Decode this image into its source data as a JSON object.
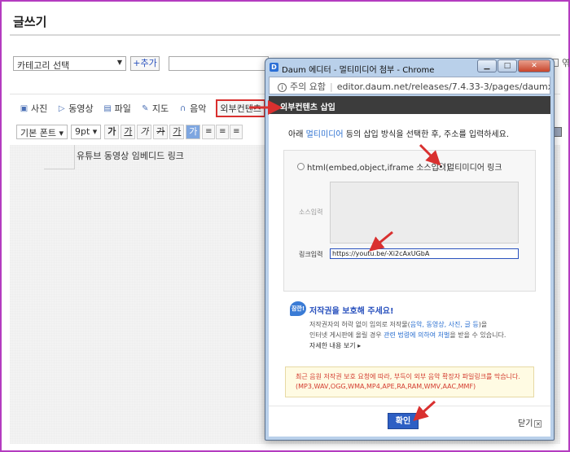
{
  "page": {
    "title": "글쓰기",
    "category_placeholder": "카테고리 선택",
    "add_label": "+추가",
    "right_label": "엮"
  },
  "toolbar": {
    "photo": "사진",
    "video": "동영상",
    "file": "파일",
    "map": "지도",
    "music": "음악",
    "external": "외부컨텐츠",
    "font": "기본 폰트",
    "size": "9pt",
    "fmt_bold": "가",
    "fmt_underline": "가",
    "fmt_italic": "가",
    "fmt_strike": "가",
    "fmt_color": "가",
    "fmt_bg": "가"
  },
  "editor": {
    "content": "유튜브 동영상 임베디드 링크"
  },
  "popup": {
    "window_title": "Daum 에디터 - 멀티미디어 첨부 - Chrome",
    "address_security": "주의 요함",
    "address_url": "editor.daum.net/releases/7.4.33-3/pages/daumx/...",
    "header": "외부컨텐츠 삽입",
    "instruction_pre": "아래 ",
    "instruction_hl": "멀티미디어",
    "instruction_post": " 등의 삽입 방식을 선택한 후, 주소를 입력하세요.",
    "radio_html": "html(embed,object,iframe 소스입력)",
    "radio_link": "멀티미디어 링크",
    "source_label": "소스입력",
    "link_label": "링크입력",
    "link_value": "https://youtu.be/-Xi2cAxUGbA",
    "copyright_badge": "잠깐!",
    "copyright_title": "저작권을 보호해 주세요!",
    "copyright_line1_pre": "저작권자의 허락 없이 임의로 저작물(",
    "copyright_line1_hl": "음악, 동영상, 사진, 글 등",
    "copyright_line1_post": ")을",
    "copyright_line2_pre": "인터넷 게시판에 올릴 경우 ",
    "copyright_line2_hl": "관련 법령에 의하여 처벌",
    "copyright_line2_post": "을 받을 수 있습니다.",
    "copyright_more": "자세한 내용 보기 ▸",
    "warning_line1": "최근 음원 저작권 보호 요청에 따라, 부득이 외부 음악 확장자 파일링크를 막습니다.",
    "warning_line2": "(MP3,WAV,OGG,WMA,MP4,APE,RA,RAM,WMV,AAC,MMF)",
    "confirm": "확인",
    "close": "닫기"
  },
  "colors": {
    "frame_border": "#b43cc0",
    "annotation_red": "#d9302f",
    "primary_blue": "#2d5fc4",
    "dialog_header": "#3c3c3c"
  }
}
